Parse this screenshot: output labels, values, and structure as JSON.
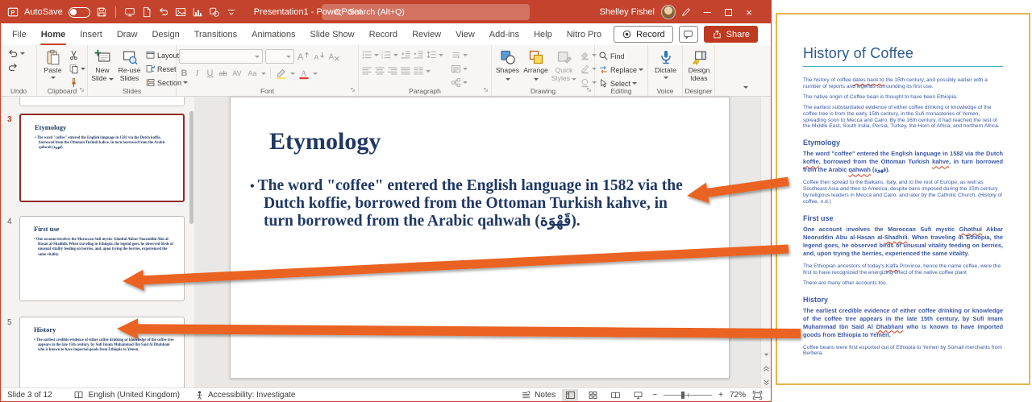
{
  "titlebar": {
    "autosave_label": "AutoSave",
    "autosave_state": "off",
    "app_title": "Presentation1 - PowerPoint",
    "search_placeholder": "Search (Alt+Q)",
    "user_name": "Shelley Fishel"
  },
  "ribbon": {
    "tabs": [
      "File",
      "Home",
      "Insert",
      "Draw",
      "Design",
      "Transitions",
      "Animations",
      "Slide Show",
      "Record",
      "Review",
      "View",
      "Add-ins",
      "Help",
      "Nitro Pro"
    ],
    "active_tab": "Home",
    "record_button": "Record",
    "share_button": "Share",
    "undo": {
      "label": "Undo"
    },
    "clipboard": {
      "label": "Clipboard",
      "paste": "Paste"
    },
    "slides": {
      "label": "Slides",
      "new_slide": "New Slide",
      "reuse_slides": "Re-use Slides",
      "layout": "Layout",
      "reset": "Reset",
      "section": "Section"
    },
    "font": {
      "label": "Font",
      "glyphs": {
        "bold": "B",
        "italic": "I",
        "underline": "U",
        "strike": "ab",
        "spacing": "AV",
        "case": "Aa"
      }
    },
    "paragraph": {
      "label": "Paragraph"
    },
    "drawing": {
      "label": "Drawing",
      "shapes": "Shapes",
      "arrange": "Arrange",
      "quick_styles": "Quick Styles"
    },
    "editing": {
      "label": "Editing",
      "find": "Find",
      "replace": "Replace",
      "select": "Select"
    },
    "voice": {
      "label": "Voice",
      "dictate": "Dictate"
    },
    "designer": {
      "label": "Designer",
      "design_ideas": "Design Ideas"
    }
  },
  "thumbnails": [
    {
      "number": "3",
      "selected": true,
      "title": "Etymology",
      "body": "The word \"coffee\" entered the English language in 1582 via the Dutch koffie, borrowed from the Ottoman Turkish kahve, in turn borrowed from the Arabic qahwah (قهوة)."
    },
    {
      "number": "4",
      "selected": false,
      "title": "First use",
      "body": "One account involves the Moroccan Sufi mystic Ghothul Akbar Nooruddin Abu al-Hasan al-Shadhili. When traveling in Ethiopia, the legend goes, he observed birds of unusual vitality feeding on berries, and, upon trying the berries, experienced the same vitality."
    },
    {
      "number": "5",
      "selected": false,
      "title": "History",
      "body": "The earliest credible evidence of either coffee drinking or knowledge of the coffee tree appears in the late 15th century, by Sufi Imam Muhammad Ibn Said Al Dhabhani who is known to have imported goods from Ethiopia to Yemen."
    }
  ],
  "slide": {
    "title": "Etymology",
    "bullet": "The word \"coffee\" entered the English language in 1582 via the Dutch koffie, borrowed from the Ottoman Turkish kahve, in turn borrowed from the Arabic qahwah (قَهْوَة)."
  },
  "document": {
    "title": "History of Coffee",
    "intro": [
      {
        "segments": [
          {
            "t": "The history of coffee "
          },
          {
            "t": "dates back to",
            "sq": true
          },
          {
            "t": " the 15th century, and possibly earlier with a number of reports and legends surrounding its first use."
          }
        ]
      },
      {
        "segments": [
          {
            "t": "The native origin of Coffee bean is thought to have been Ethiopia."
          }
        ]
      },
      {
        "segments": [
          {
            "t": "The earliest substantiated evidence of either coffee drinking or knowledge of the coffee tree is from the early 15th century, in the Sufi monasteries of Yemen, spreading soon to Mecca and Cairo. By the 16th century, it had reached the rest of the Middle East, South India, Persia, Turkey, the Horn of Africa, and northern Africa."
          }
        ]
      }
    ],
    "sections": [
      {
        "heading": "Etymology",
        "paragraphs": [
          {
            "bold": true,
            "segments": [
              {
                "t": "The word \"coffee\" entered the English language in 1582 via the Dutch "
              },
              {
                "t": "koffie",
                "sq": true
              },
              {
                "t": ", borrowed from the Ottoman Turkish "
              },
              {
                "t": "kahve",
                "sq": true
              },
              {
                "t": ", in turn borrowed from the Arabic "
              },
              {
                "t": "qahwah",
                "sq": true
              },
              {
                "t": " (قهوة)."
              }
            ]
          },
          {
            "segments": [
              {
                "t": "Coffee then spread to the Balkans, Italy, and to the rest of Europe, as well as Southeast Asia and then to America, despite bans imposed during the 15th century by religious leaders in Mecca and Cairo, and later by the Catholic Church. (History of coffee, n.d.)"
              }
            ]
          }
        ]
      },
      {
        "heading": "First use",
        "paragraphs": [
          {
            "bold": true,
            "segments": [
              {
                "t": "One account involves the Moroccan Sufi mystic "
              },
              {
                "t": "Ghothul",
                "sq": true
              },
              {
                "t": " Akbar Nooruddin Abu al-Hasan al-"
              },
              {
                "t": "Shadhili",
                "sq": true
              },
              {
                "t": ". When traveling in Ethiopia, the legend goes, he observed birds of unusual vitality feeding on berries, and, upon trying the berries, experienced the same vitality."
              }
            ]
          },
          {
            "segments": [
              {
                "t": "The Ethiopian ancestors of today's "
              },
              {
                "t": "Kaffa",
                "sq": true
              },
              {
                "t": " Province, hence the name coffee, were the first to have recognized the energizing effect of the native coffee plant"
              }
            ]
          },
          {
            "segments": [
              {
                "t": "There are many other accounts too."
              }
            ]
          }
        ]
      },
      {
        "heading": "History",
        "paragraphs": [
          {
            "bold": true,
            "segments": [
              {
                "t": "The earliest credible evidence of either coffee drinking or knowledge of the coffee tree appears in the late 15th century, by Sufi Imam Muhammad Ibn Said Al "
              },
              {
                "t": "Dhabhani",
                "sq": true
              },
              {
                "t": " who is known to have imported goods from Ethiopia to Yemen."
              }
            ]
          },
          {
            "segments": [
              {
                "t": "Coffee beans were first exported out of Ethiopia to Yemen by Somali merchants from Berbera."
              }
            ]
          }
        ]
      }
    ]
  },
  "statusbar": {
    "slide_info": "Slide 3 of 12",
    "language": "English (United Kingdom)",
    "accessibility": "Accessibility: Investigate",
    "notes_label": "Notes",
    "zoom_level": "72%"
  },
  "colors": {
    "titlebar_red": "#C4432C",
    "share_red": "#BE3A1F",
    "slide_text_navy": "#1F3864",
    "doc_text_blue": "#3A57A8",
    "doc_title_blue": "#2E5B8C",
    "panel_border_gold": "#E6B549",
    "arrow_orange": "#EA6423",
    "selected_thumb_red": "#8E2A26"
  }
}
